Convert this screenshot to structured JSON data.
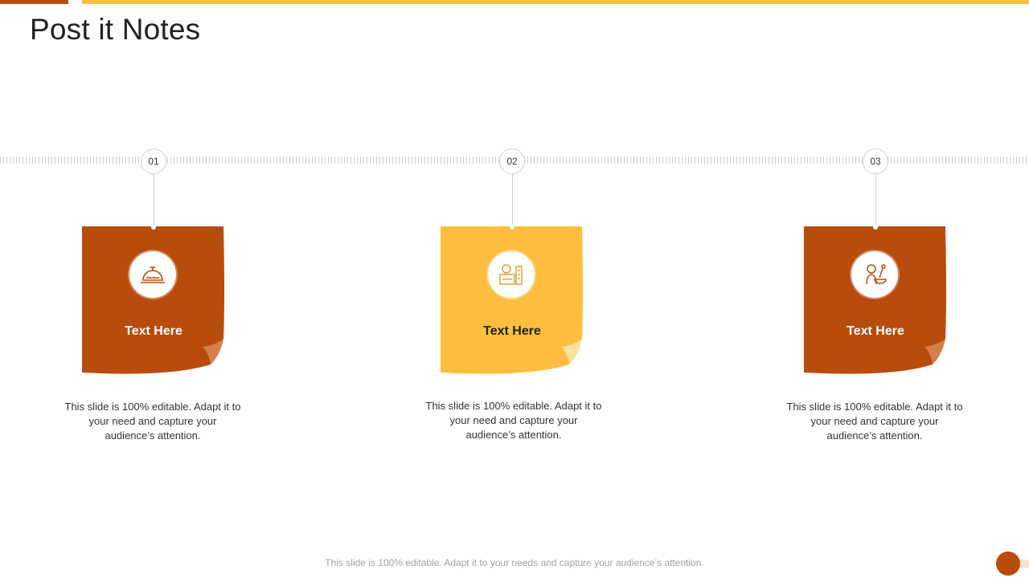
{
  "title": "Post it Notes",
  "colors": {
    "dark": "#b84c0d",
    "light": "#fdbe3f",
    "gray": "#cfcfcf"
  },
  "notes": [
    {
      "number": "01",
      "title": "Text Here",
      "icon": "service-bell-icon",
      "color": "#b84c0d",
      "description": "This slide is 100% editable. Adapt it to your need and capture your audience’s attention."
    },
    {
      "number": "02",
      "title": "Text Here",
      "icon": "factory-icon",
      "color": "#fdbe3f",
      "description": "This slide is 100% editable. Adapt it to your need and capture your audience’s attention."
    },
    {
      "number": "03",
      "title": "Text Here",
      "icon": "chef-cooking-icon",
      "color": "#b84c0d",
      "description": "This slide is 100% editable. Adapt it to your need and capture your audience’s attention."
    }
  ],
  "footer": "This slide is 100% editable. Adapt it to your needs and capture your audience’s attention."
}
